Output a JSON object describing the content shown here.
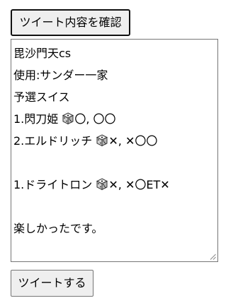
{
  "buttons": {
    "confirm_label": "ツイート内容を確認",
    "tweet_label": "ツイートする"
  },
  "tweet_text": {
    "lines": [
      {
        "text": "毘沙門天cs"
      },
      {
        "text": "使用:サンダー一家"
      },
      {
        "text": "予選スイス"
      },
      {
        "prefix": "1.閃刀姫 ",
        "icon": "dice-icon",
        "suffix": "〇, 〇〇"
      },
      {
        "prefix": "2.エルドリッチ ",
        "icon": "dice-icon",
        "suffix": "✕, ✕〇〇"
      },
      {
        "text": ""
      },
      {
        "prefix": "1.ドライトロン ",
        "icon": "dice-icon",
        "suffix": "✕, ✕〇ET✕"
      },
      {
        "text": ""
      },
      {
        "text": "楽しかったです。"
      }
    ]
  }
}
